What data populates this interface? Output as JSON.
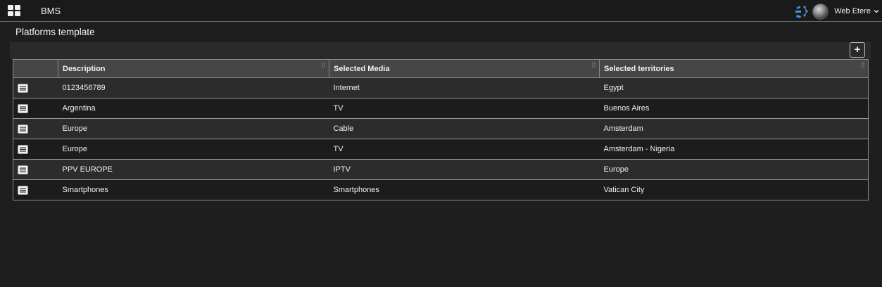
{
  "header": {
    "app_title": "BMS",
    "user_name": "Web Etere",
    "icons": [
      "apps-grid-icon",
      "etere-brand-icon",
      "user-avatar",
      "chevron-down-icon"
    ]
  },
  "page": {
    "title": "Platforms template",
    "add_icon": "plus-icon"
  },
  "table": {
    "columns": [
      "Description",
      "Selected Media",
      "Selected territories"
    ],
    "rows": [
      {
        "description": "0123456789",
        "media": "Internet",
        "territories": "Egypt"
      },
      {
        "description": "Argentina",
        "media": "TV",
        "territories": "Buenos Aires"
      },
      {
        "description": "Europe",
        "media": "Cable",
        "territories": "Amsterdam"
      },
      {
        "description": "Europe",
        "media": "TV",
        "territories": "Amsterdam - Nigeria"
      },
      {
        "description": "PPV EUROPE",
        "media": "IPTV",
        "territories": "Europe"
      },
      {
        "description": "Smartphones",
        "media": "Smartphones",
        "territories": "Vatican City"
      }
    ],
    "row_menu_icon": "hamburger-menu-icon",
    "sort_icon": "sort-icon"
  },
  "colors": {
    "background": "#1e1e1e",
    "header_row": "#464646",
    "row_odd": "#2c2c2c",
    "row_even": "#1c1c1c",
    "brand_blue": "#4a90d9"
  }
}
